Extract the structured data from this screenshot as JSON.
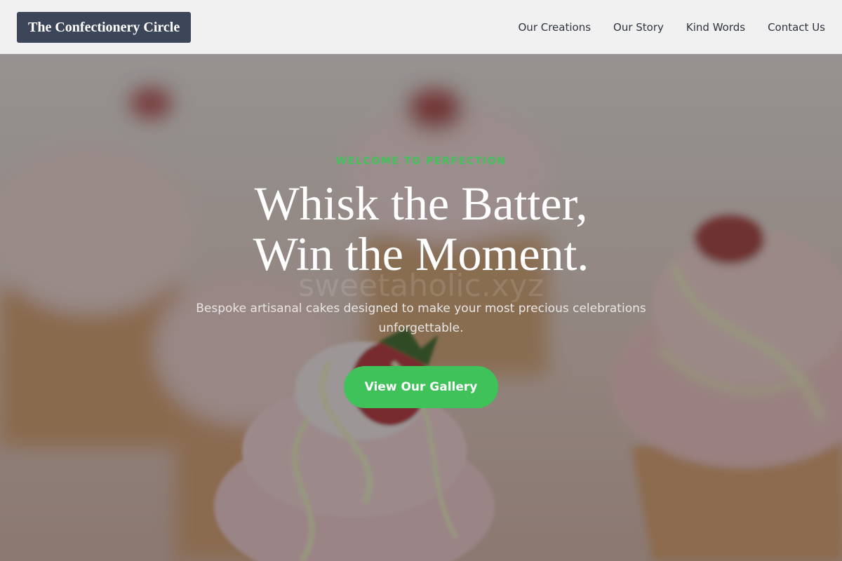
{
  "header": {
    "logo_text": "The Confectionery Circle",
    "nav": [
      {
        "label": "Our Creations"
      },
      {
        "label": "Our Story"
      },
      {
        "label": "Kind Words"
      },
      {
        "label": "Contact Us"
      }
    ]
  },
  "hero": {
    "eyebrow": "WELCOME TO PERFECTION",
    "headline_line1": "Whisk the Batter,",
    "headline_line2": "Win the Moment.",
    "subline": "Bespoke artisanal cakes designed to make your most precious celebrations unforgettable.",
    "cta_label": "View Our Gallery",
    "watermark": "sweetaholic.xyz"
  },
  "colors": {
    "header_bg": "#f0f0f0",
    "logo_bg": "#3c4658",
    "accent_green": "#3fc25a",
    "nav_text": "#2e3440"
  }
}
